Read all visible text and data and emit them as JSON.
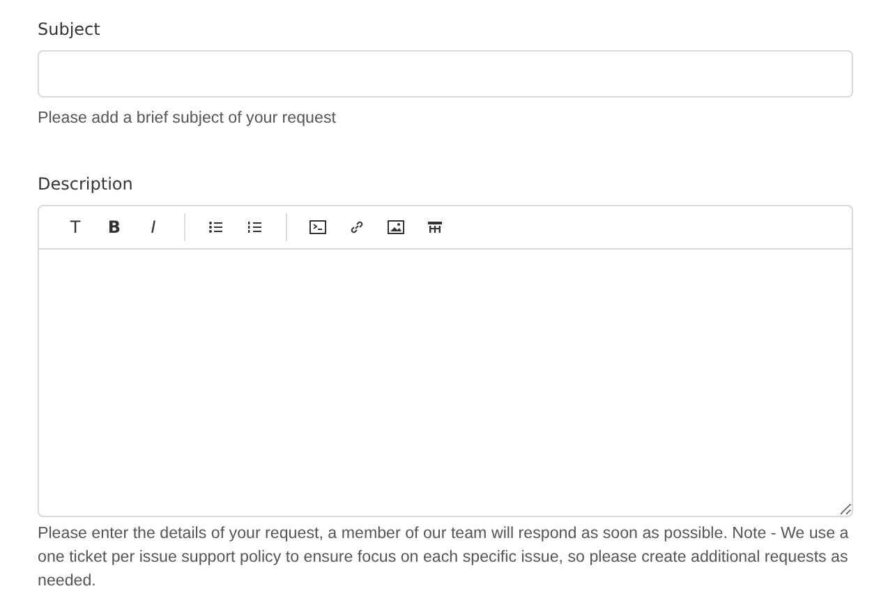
{
  "subject": {
    "label": "Subject",
    "help": "Please add a brief subject of your request"
  },
  "description": {
    "label": "Description",
    "toolbar_text_buttons": [
      "T",
      "B",
      "I"
    ],
    "help": "Please enter the details of your request, a member of our team will respond as soon as possible. Note - We use a one ticket per issue support policy to ensure focus on each specific issue, so please create additional requests as needed."
  }
}
